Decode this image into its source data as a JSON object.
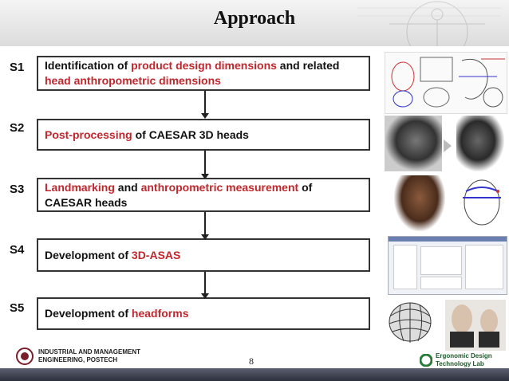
{
  "slide": {
    "title": "Approach",
    "page_number": "8"
  },
  "steps": [
    {
      "label": "S1",
      "parts": [
        {
          "text": "Identification of ",
          "hl": false
        },
        {
          "text": "product design dimensions",
          "hl": true
        },
        {
          "text": " and related ",
          "hl": false
        },
        {
          "text": "head anthropometric dimensions",
          "hl": true
        }
      ]
    },
    {
      "label": "S2",
      "parts": [
        {
          "text": "Post-processing",
          "hl": true
        },
        {
          "text": " of CAESAR 3D heads",
          "hl": false
        }
      ]
    },
    {
      "label": "S3",
      "parts": [
        {
          "text": "Landmarking",
          "hl": true
        },
        {
          "text": " and ",
          "hl": false
        },
        {
          "text": "anthropometric measurement",
          "hl": true
        },
        {
          "text": " of CAESAR heads",
          "hl": false
        }
      ]
    },
    {
      "label": "S4",
      "parts": [
        {
          "text": "Development of ",
          "hl": false
        },
        {
          "text": "3D-ASAS",
          "hl": true
        }
      ]
    },
    {
      "label": "S5",
      "parts": [
        {
          "text": "Development of ",
          "hl": false
        },
        {
          "text": "headforms",
          "hl": true
        }
      ]
    }
  ],
  "footer": {
    "left_line1": "INDUSTRIAL AND MANAGEMENT",
    "left_line2": "ENGINEERING, POSTECH",
    "right_line1": "Ergonomic Design",
    "right_line2": "Technology Lab"
  },
  "colors": {
    "highlight": "#c0272d",
    "text": "#111111",
    "footer_bar": "#3a3e4c"
  },
  "icons": [
    "postech-logo-icon",
    "ergonomic-lab-logo-icon"
  ]
}
